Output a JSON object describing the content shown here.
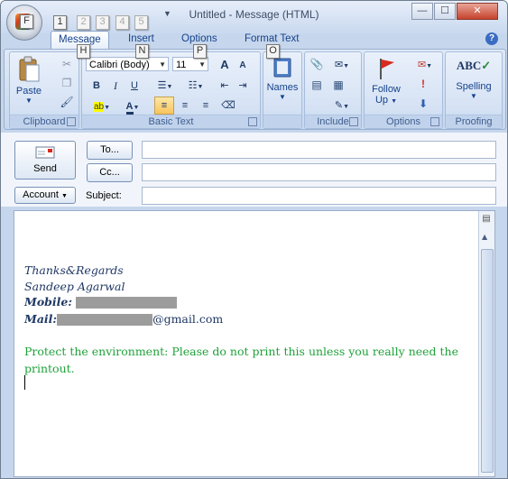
{
  "window": {
    "title": "Untitled - Message (HTML)",
    "controls": {
      "minimize": "—",
      "maximize": "☐",
      "close": "✕"
    }
  },
  "qat_keytips": [
    "1",
    "2",
    "3",
    "4",
    "5"
  ],
  "office_keytip": "F",
  "tabs": [
    {
      "label": "Message",
      "keytip": "H",
      "active": true
    },
    {
      "label": "Insert",
      "keytip": "N",
      "active": false
    },
    {
      "label": "Options",
      "keytip": "P",
      "active": false
    },
    {
      "label": "Format Text",
      "keytip": "O",
      "active": false
    }
  ],
  "help_icon": "?",
  "ribbon": {
    "clipboard": {
      "label": "Clipboard",
      "paste": "Paste"
    },
    "basic_text": {
      "label": "Basic Text",
      "font": "Calibri (Body)",
      "size": "11",
      "bold": "B",
      "italic": "I",
      "underline": "U",
      "grow": "A",
      "shrink": "A"
    },
    "names": {
      "label": "Names"
    },
    "include": {
      "label": "Include"
    },
    "options": {
      "label": "Options",
      "follow_up_1": "Follow",
      "follow_up_2": "Up"
    },
    "proofing": {
      "label": "Proofing",
      "spelling": "Spelling",
      "abc": "ABC"
    }
  },
  "header": {
    "send": "Send",
    "to": "To...",
    "cc": "Cc...",
    "account": "Account",
    "subject": "Subject:"
  },
  "body": {
    "sign_off": "Thanks&Regards",
    "name": "Sandeep Agarwal",
    "mobile_label": "Mobile:",
    "mail_label": "Mail:",
    "mail_domain": "@gmail.com",
    "footer_line1": "Protect the environment: Please do not print this unless you really need the",
    "footer_line2": "printout."
  },
  "colors": {
    "signature": "#1f3864",
    "footer": "#1fa23a",
    "ribbon_bg": "#d5e2f4",
    "highlight_selected": "#f8c45c"
  }
}
